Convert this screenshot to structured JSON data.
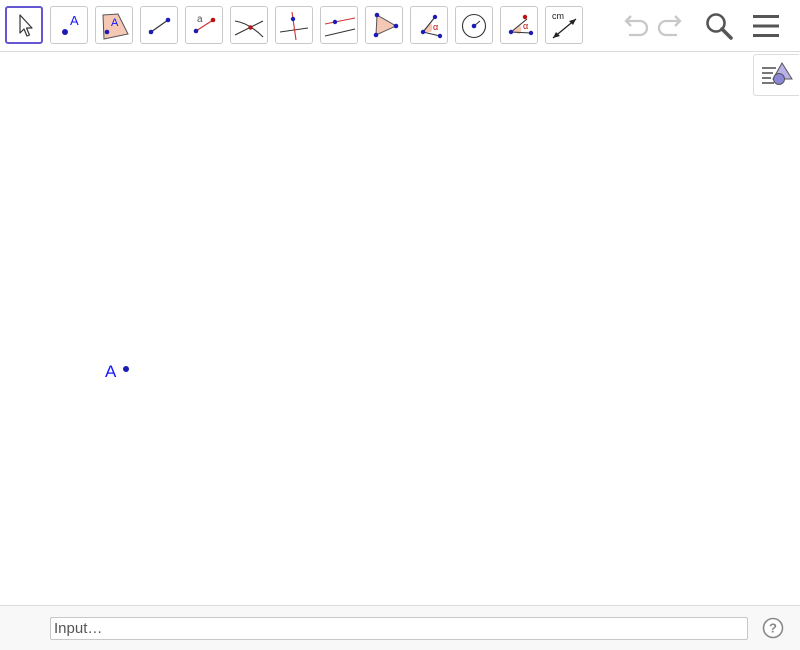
{
  "toolbar": {
    "tools": [
      {
        "name": "move-tool",
        "icon": "cursor-arrow-icon",
        "active": true
      },
      {
        "name": "point-tool",
        "icon": "point-icon",
        "glyph": "A"
      },
      {
        "name": "text-tool",
        "icon": "text-polygon-icon",
        "glyph": "A"
      },
      {
        "name": "segment-tool",
        "icon": "segment-icon"
      },
      {
        "name": "segment-fixed-length-tool",
        "icon": "segment-with-length-icon",
        "glyph": "a"
      },
      {
        "name": "intersect-tool",
        "icon": "intersect-icon"
      },
      {
        "name": "perpendicular-line-tool",
        "icon": "perpendicular-line-icon"
      },
      {
        "name": "parallel-line-tool",
        "icon": "parallel-line-icon"
      },
      {
        "name": "polygon-tool",
        "icon": "polygon-icon"
      },
      {
        "name": "angle-tool",
        "icon": "angle-icon",
        "glyph": "α"
      },
      {
        "name": "circle-tool",
        "icon": "circle-center-icon"
      },
      {
        "name": "angle-given-size-tool",
        "icon": "angle-given-size-icon",
        "glyph": "α"
      },
      {
        "name": "distance-tool",
        "icon": "distance-icon",
        "glyph": "cm"
      }
    ],
    "actions": [
      "undo-icon",
      "redo-icon",
      "search-icon",
      "menu-icon"
    ]
  },
  "canvas": {
    "points": [
      {
        "label": "A"
      }
    ]
  },
  "input_bar": {
    "placeholder": "Input…",
    "help_glyph": "?"
  },
  "colors": {
    "point": "#1c1cb4",
    "label": "#1515ff",
    "accent": "#6557d2",
    "fill": "#f4c8b4"
  }
}
